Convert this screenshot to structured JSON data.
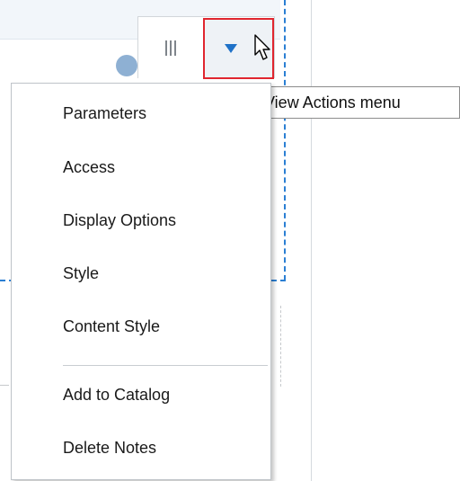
{
  "toolbar": {
    "grip_icon": "vertical-grip-icon",
    "actions_icon": "dropdown-triangle-icon",
    "accent_color": "#1f72c8",
    "highlight_color": "#e0262f"
  },
  "tooltip": {
    "text": "View Actions menu"
  },
  "menu": {
    "items": [
      {
        "label": "Parameters"
      },
      {
        "label": "Access"
      },
      {
        "label": "Display Options"
      },
      {
        "label": "Style"
      },
      {
        "label": "Content Style"
      },
      {
        "label": "Add to Catalog"
      },
      {
        "label": "Delete Notes"
      }
    ]
  }
}
